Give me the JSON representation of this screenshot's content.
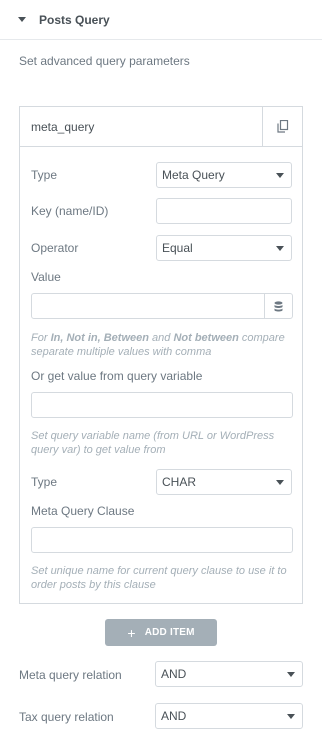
{
  "section": {
    "title": "Posts Query"
  },
  "description": "Set advanced query parameters",
  "repeater": {
    "item_title": "meta_query",
    "type": {
      "label": "Type",
      "value": "Meta Query"
    },
    "key": {
      "label": "Key (name/ID)",
      "value": ""
    },
    "operator": {
      "label": "Operator",
      "value": "Equal"
    },
    "value_field": {
      "label": "Value",
      "value": ""
    },
    "value_help": {
      "p1": "For ",
      "b1": "In, Not in, Between",
      "p2": " and ",
      "b2": "Not between",
      "p3": " compare separate multiple values with comma"
    },
    "query_var": {
      "label": "Or get value from query variable",
      "value": "",
      "help": "Set query variable name (from URL or WordPress query var) to get value from"
    },
    "value_type": {
      "label": "Type",
      "value": "CHAR"
    },
    "clause": {
      "label": "Meta Query Clause",
      "value": "",
      "help": "Set unique name for current query clause to use it to order posts by this clause"
    }
  },
  "add_item": {
    "label": "ADD ITEM",
    "icon": "+"
  },
  "meta_relation": {
    "label": "Meta query relation",
    "value": "AND"
  },
  "tax_relation": {
    "label": "Tax query relation",
    "value": "AND"
  }
}
